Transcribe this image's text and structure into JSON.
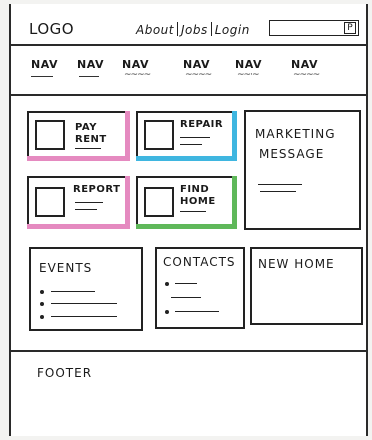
{
  "header": {
    "logo": "LOGO",
    "links": [
      "About",
      "Jobs",
      "Login"
    ],
    "search_button": "P"
  },
  "nav": {
    "items": [
      "NAV",
      "NAV",
      "NAV",
      "NAV",
      "NAV",
      "NAV"
    ]
  },
  "tiles": [
    {
      "title_1": "PAY",
      "title_2": "RENT",
      "stripe_color": "#e58ac0"
    },
    {
      "title_1": "REPAIR",
      "title_2": "",
      "stripe_color": "#3fb6e0"
    },
    {
      "title_1": "REPORT",
      "title_2": "",
      "stripe_color": "#e58ac0"
    },
    {
      "title_1": "FIND",
      "title_2": "HOME",
      "stripe_color": "#5fb85a"
    }
  ],
  "marketing": {
    "line_1": "MARKETING",
    "line_2": "MESSAGE"
  },
  "events": {
    "title": "EVENTS"
  },
  "contacts": {
    "title": "CONTACTS"
  },
  "new_home": {
    "title": "NEW HOME"
  },
  "footer": {
    "label": "FOOTER"
  }
}
